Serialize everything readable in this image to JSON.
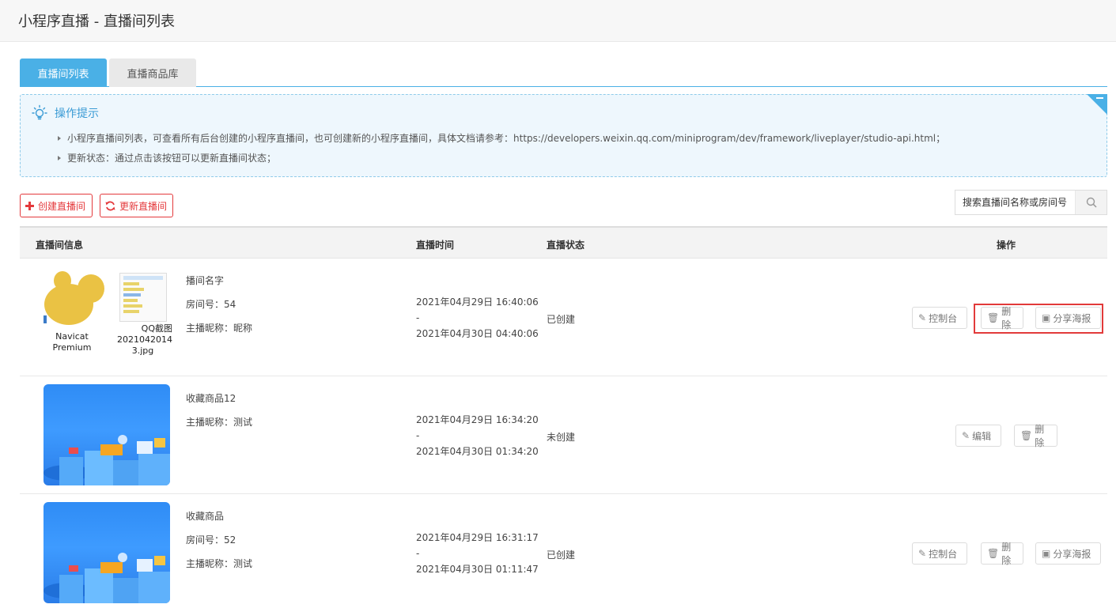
{
  "header": {
    "title": "小程序直播 - 直播间列表"
  },
  "tabs": [
    {
      "label": "直播间列表",
      "active": true
    },
    {
      "label": "直播商品库",
      "active": false
    }
  ],
  "tips": {
    "title": "操作提示",
    "lines": [
      "小程序直播间列表，可查看所有后台创建的小程序直播间，也可创建新的小程序直播间，具体文档请参考：https://developers.weixin.qq.com/miniprogram/dev/framework/liveplayer/studio-api.html；",
      "更新状态：通过点击该按钮可以更新直播间状态；"
    ]
  },
  "toolbar": {
    "create_label": "创建直播间",
    "refresh_label": "更新直播间",
    "search_placeholder": "搜索直播间名称或房间号"
  },
  "table": {
    "headers": {
      "info": "直播间信息",
      "time": "直播时间",
      "status": "直播状态",
      "actions": "操作"
    },
    "rows": [
      {
        "thumbs": [
          {
            "type": "navicat",
            "caption": "Navicat Premium"
          },
          {
            "type": "qq",
            "caption1": "QQ截图",
            "caption2": "2021042014",
            "caption3": "3.jpg"
          }
        ],
        "name": "播间名字",
        "room": "房间号：54",
        "anchor": "主播昵称：昵称",
        "start": "2021年04月29日 16:40:06",
        "sep": "-",
        "end": "2021年04月30日 04:40:06",
        "status": "已创建",
        "actions": [
          "控制台",
          "删除",
          "分享海报"
        ]
      },
      {
        "thumbs": [
          {
            "type": "blue"
          }
        ],
        "name": "收藏商品12",
        "anchor": "主播昵称：测试",
        "start": "2021年04月29日 16:34:20",
        "sep": "-",
        "end": "2021年04月30日 01:34:20",
        "status": "未创建",
        "actions": [
          "编辑",
          "删除"
        ]
      },
      {
        "thumbs": [
          {
            "type": "blue"
          }
        ],
        "name": "收藏商品",
        "room": "房间号：52",
        "anchor": "主播昵称：测试",
        "start": "2021年04月29日 16:31:17",
        "sep": "-",
        "end": "2021年04月30日 01:11:47",
        "status": "已创建",
        "actions": [
          "控制台",
          "删除",
          "分享海报"
        ]
      }
    ]
  },
  "icons": {
    "bulb": "lightbulb-icon",
    "plus": "plus-icon",
    "refresh": "refresh-icon",
    "search": "search-icon",
    "edit": "edit-icon",
    "trash": "trash-icon",
    "image": "image-icon"
  },
  "colors": {
    "accent": "#4ab0e6",
    "danger": "#e4393c",
    "tips_bg": "#eef7fd"
  }
}
